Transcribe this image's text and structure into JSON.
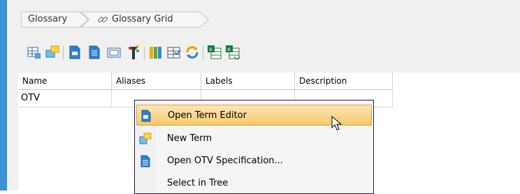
{
  "breadcrumb": {
    "items": [
      "Glossary",
      "Glossary Grid"
    ],
    "link_icon": "chain-link-icon"
  },
  "toolbar": {
    "icons": [
      "grid-view-icon",
      "add-element-icon",
      "new-term-icon",
      "open-spec-icon",
      "open-diagram-icon",
      "filter-icon",
      "color-columns-icon",
      "grid-options-icon",
      "refresh-icon",
      "export-excel-icon",
      "import-excel-icon"
    ]
  },
  "grid": {
    "columns": [
      "Name",
      "Aliases",
      "Labels",
      "Description"
    ],
    "rows": [
      {
        "name": "OTV",
        "aliases": "",
        "labels": "",
        "description": ""
      }
    ]
  },
  "context_menu": {
    "items": [
      {
        "label": "Open Term Editor",
        "icon": "term-editor-icon",
        "highlighted": true
      },
      {
        "label": "New Term",
        "icon": "new-term-icon",
        "highlighted": false
      },
      {
        "label": "Open OTV Specification...",
        "icon": "specification-icon",
        "highlighted": false
      },
      {
        "label": "Select in Tree",
        "icon": "",
        "highlighted": false
      }
    ]
  },
  "colors": {
    "accent_stripe": "#3d8fd6",
    "menu_highlight": "#f7c76b",
    "menu_border": "#1f1f5a"
  }
}
